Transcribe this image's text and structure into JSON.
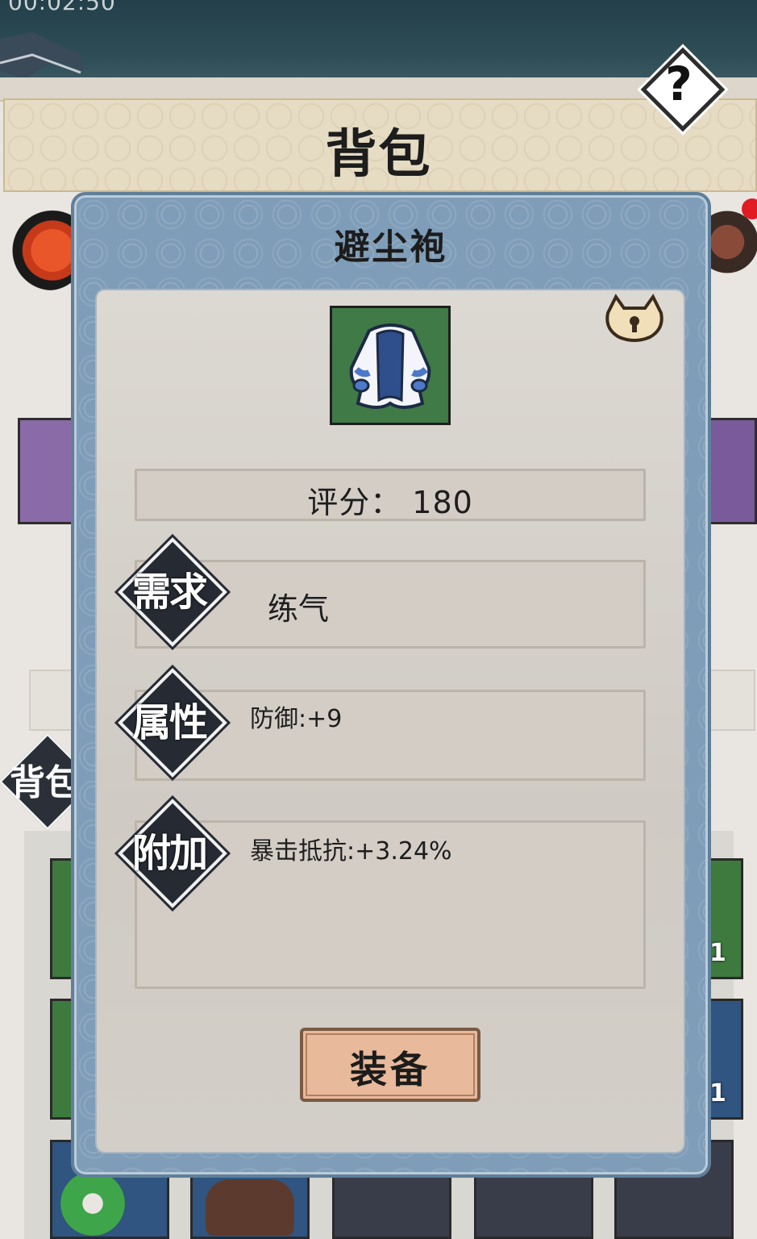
{
  "status": {
    "timer": "00:02:50"
  },
  "header": {
    "title": "背包",
    "help_label": "?"
  },
  "side_tab": {
    "label": "背包"
  },
  "slot_counts": [
    "1",
    "1"
  ],
  "dialog": {
    "title": "避尘袍",
    "item_icon": "robe-icon",
    "lock_icon": "lock-icon",
    "score": "评分：  180",
    "requirement": {
      "tag": "需求",
      "value": "练气"
    },
    "attributes": {
      "tag": "属性",
      "value": "防御:+9"
    },
    "extra": {
      "tag": "附加",
      "value": "暴击抵抗:+3.24%"
    },
    "equip_label": "装备"
  },
  "colors": {
    "dialog_frame": "#7f9db8",
    "panel": "#d6d2cc",
    "item_frame": "#3f7a47",
    "button": "#e8b99a"
  }
}
